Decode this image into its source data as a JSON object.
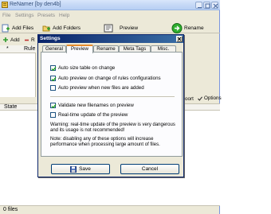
{
  "app": {
    "title": "ReNamer [by den4b]"
  },
  "menu": [
    "File",
    "Settings",
    "Presets",
    "Help"
  ],
  "toolbar": {
    "add_files": "Add Files",
    "add_folders": "Add Folders",
    "preview": "Preview",
    "rename": "Rename"
  },
  "rules_bar": {
    "add": "Add",
    "remove": "R"
  },
  "rules_table": {
    "col_num": "*",
    "col_rule": "Rule"
  },
  "files_bar": {
    "sort": "oort",
    "options": "Options"
  },
  "files_table": {
    "col_state": "State"
  },
  "status": {
    "files_count": "0 files"
  },
  "dialog": {
    "title": "Settings",
    "tabs": [
      "General",
      "Preview",
      "Rename",
      "Meta Tags",
      "Misc."
    ],
    "active_tab": "Preview",
    "options": [
      {
        "label": "Auto size table on change",
        "checked": true
      },
      {
        "label": "Auto preview on change of rules configurations",
        "checked": true
      },
      {
        "label": "Auto preview when new files are added",
        "checked": false
      },
      {
        "label": "Validate new filenames on preview",
        "checked": true
      },
      {
        "label": "Real-time update of the preview",
        "checked": false
      }
    ],
    "warning": "Warning: real-time update of the preview is very dangerous and its usage is not recommended!",
    "note": "Note: disabling any of these options will increase performance when processing large amount of files.",
    "save_label": "Save",
    "cancel_label": "Cancel"
  },
  "colors": {
    "accent": "#0a246a",
    "tab_highlight": "#e68b2c",
    "check": "#21a121"
  }
}
